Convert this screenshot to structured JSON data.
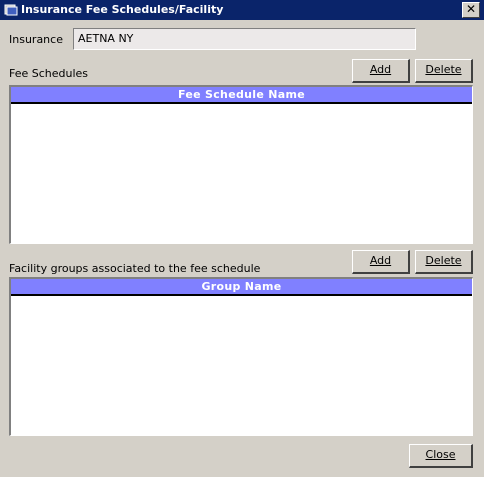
{
  "window": {
    "title": "Insurance Fee Schedules/Facility",
    "icon": "window-app-icon",
    "close_label": "✕"
  },
  "insurance": {
    "label": "Insurance",
    "value": "AETNA NY"
  },
  "fee_schedules": {
    "label": "Fee Schedules",
    "add_label": "Add",
    "delete_label": "Delete",
    "column_header": "Fee Schedule Name",
    "rows": []
  },
  "facility_groups": {
    "label": "Facility groups associated to the fee schedule",
    "add_label": "Add",
    "delete_label": "Delete",
    "column_header": "Group Name",
    "rows": []
  },
  "footer": {
    "close_label": "Close"
  },
  "colors": {
    "titlebar": "#0a246a",
    "header": "#8080ff",
    "window_bg": "#d4d0c8"
  }
}
